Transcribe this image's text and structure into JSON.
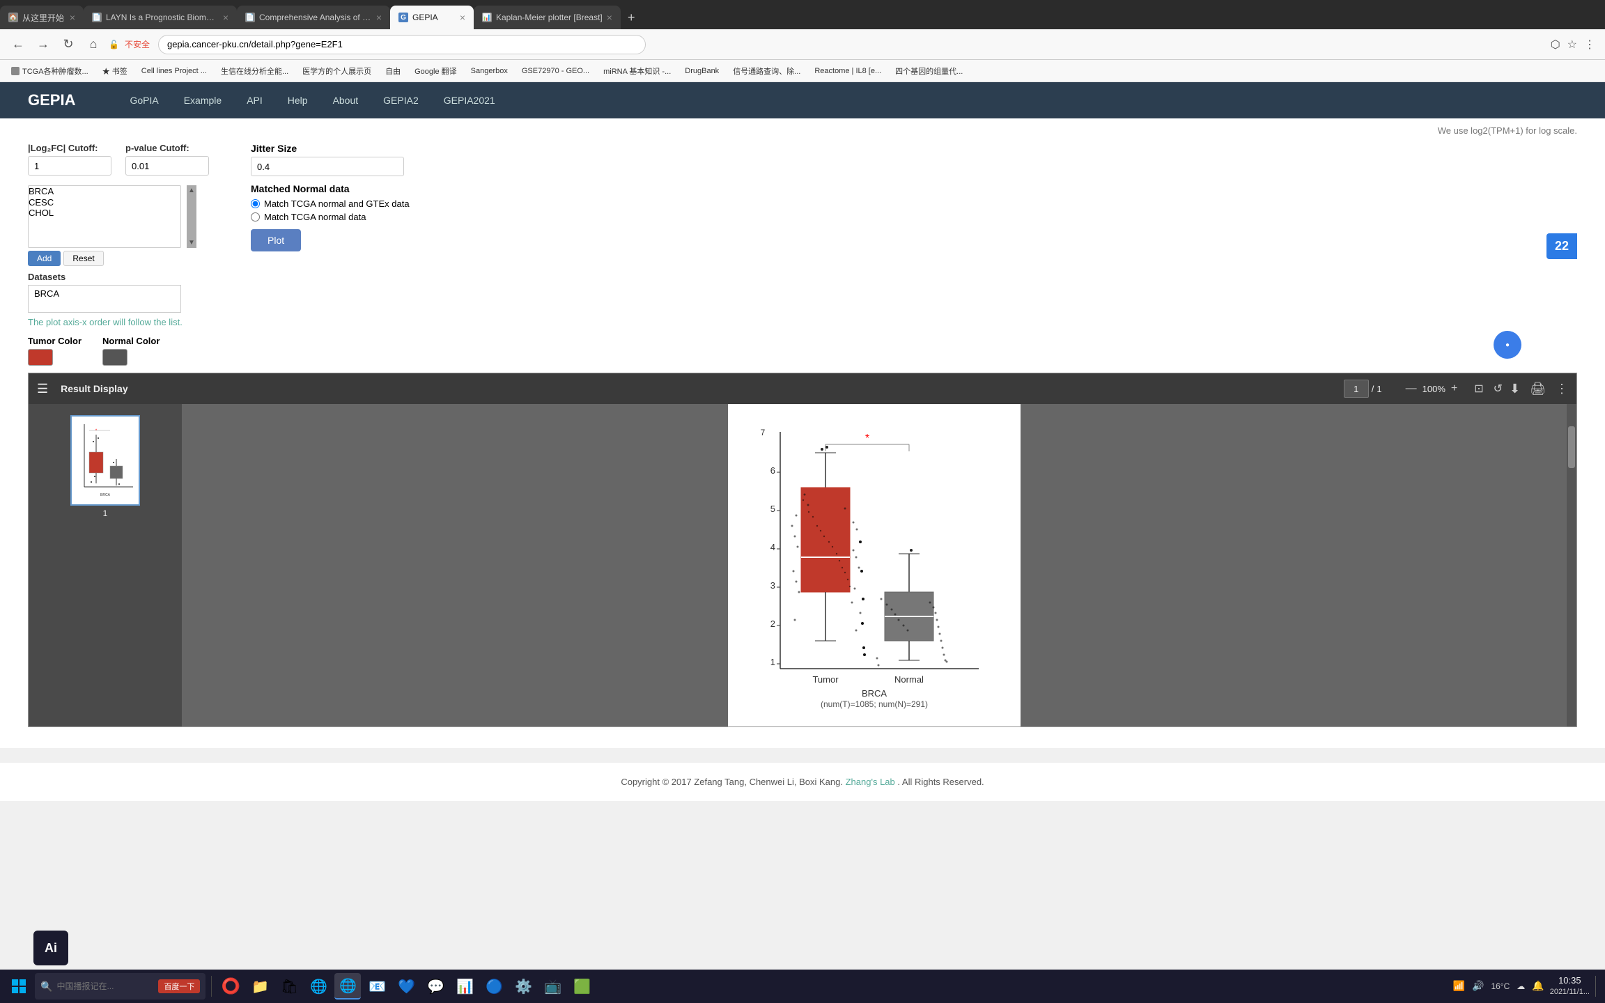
{
  "browser": {
    "tabs": [
      {
        "id": "tab1",
        "title": "从这里开始",
        "active": false,
        "favicon": "🏠"
      },
      {
        "id": "tab2",
        "title": "LAYN Is a Prognostic Biomarker...",
        "active": false,
        "favicon": "📄"
      },
      {
        "id": "tab3",
        "title": "Comprehensive Analysis of th...",
        "active": false,
        "favicon": "📄"
      },
      {
        "id": "tab4",
        "title": "GEPIA",
        "active": true,
        "favicon": "G"
      },
      {
        "id": "tab5",
        "title": "Kaplan-Meier plotter [Breast]",
        "active": false,
        "favicon": "📊"
      }
    ],
    "address": "gepia.cancer-pku.cn/detail.php?gene=E2F1",
    "security": "不安全"
  },
  "bookmarks": [
    "TCGA各种肿瘤数...",
    "书签",
    "Cell lines Project ...",
    "生信在线分析全能...",
    "医学方的个人展示页",
    "自由",
    "Google 翻译",
    "Sangerbox",
    "GSE72970 - GEO...",
    "miRNA 基本知识 -...",
    "DrugBank",
    "信号通路查询、除...",
    "Reactome | IL8 [e...",
    "四个基因的组量代..."
  ],
  "nav": {
    "logo": "GEPIA",
    "links": [
      "GoPIA",
      "Example",
      "API",
      "Help",
      "About",
      "GEPIA2",
      "GEPIA2021"
    ]
  },
  "form": {
    "log2fc_label": "|Log₂FC| Cutoff:",
    "log2fc_value": "1",
    "pvalue_label": "p-value Cutoff:",
    "pvalue_value": "0.01",
    "tumor_color_label": "Tumor Color",
    "normal_color_label": "Normal Color",
    "datasets_label": "Datasets",
    "datasets_options": [
      "BRCA",
      "CESC",
      "CHOL"
    ],
    "selected_datasets": [
      "BRCA"
    ],
    "add_btn": "Add",
    "reset_btn": "Reset",
    "axis_note": "The plot axis-x order will follow the list.",
    "log_note": "We use log2(TPM+1) for log scale.",
    "jitter_label": "Jitter Size",
    "jitter_value": "0.4",
    "matched_label": "Matched Normal data",
    "radio1": "Match TCGA normal and GTEx data",
    "radio2": "Match TCGA normal data",
    "plot_btn": "Plot"
  },
  "pdf_viewer": {
    "title": "Result Display",
    "page_current": "1",
    "page_total": "1",
    "zoom": "100%",
    "chart": {
      "dataset_label": "BRCA",
      "sample_info": "(num(T)=1085; num(N)=291)",
      "y_axis_label": "",
      "significance": "*",
      "tumor_color": "#c0392b",
      "normal_color": "#666666"
    }
  },
  "footer": {
    "text": "Copyright © 2017 Zefang Tang, Chenwei Li, Boxi Kang.",
    "link_text": "Zhang's Lab",
    "suffix": ". All Rights Reserved."
  },
  "taskbar": {
    "time": "10:35",
    "date": "2021/11/1...",
    "temperature": "16°C",
    "search_placeholder": "中国播报记在...",
    "search_btn": "百度一下"
  },
  "floating": {
    "number": "22"
  }
}
